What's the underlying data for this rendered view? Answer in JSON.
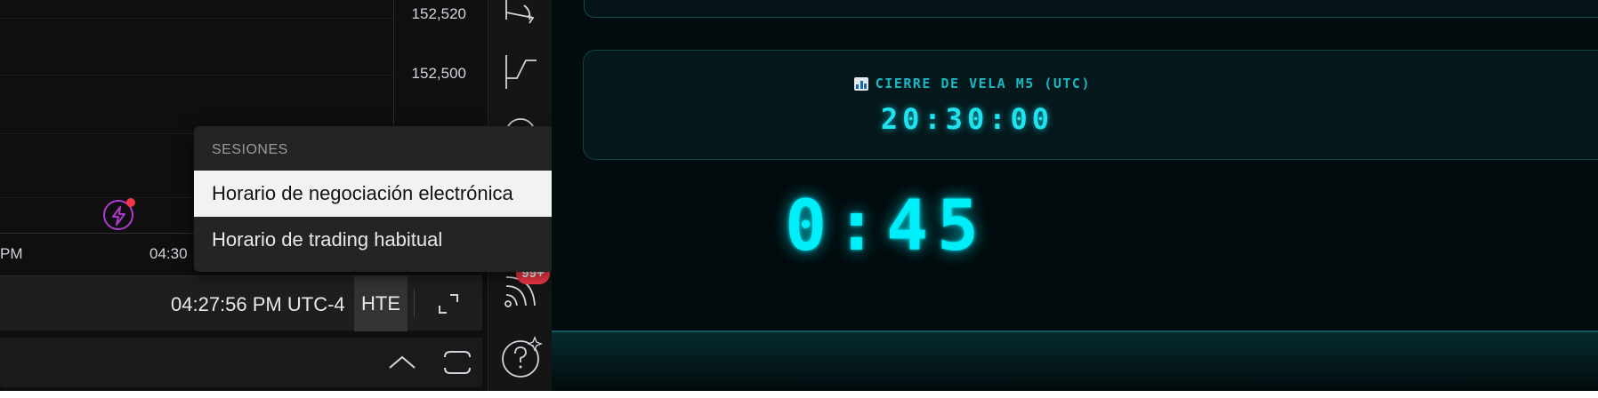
{
  "chart": {
    "price_labels": [
      "152,520",
      "152,500"
    ],
    "time_labels": [
      "PM",
      "04:30"
    ]
  },
  "status_bar": {
    "clock": "04:27:56 PM UTC-4",
    "session_button": "HTE"
  },
  "session_menu": {
    "header": "SESIONES",
    "items": [
      {
        "label": "Horario de negociación electrónica",
        "selected": true
      },
      {
        "label": "Horario de trading habitual",
        "selected": false
      }
    ]
  },
  "toolbar": {
    "notification_badge": "99+",
    "icons": [
      "trend-angle-icon",
      "pitchfork-icon",
      "circle-tool-icon",
      "signal-feed-icon",
      "help-sparkle-icon"
    ]
  },
  "candle_panel": {
    "label": "CIERRE DE VELA M5 (UTC)",
    "close_time": "20:30:00",
    "countdown": "0:45"
  },
  "colors": {
    "accent_cyan": "#00eefa",
    "panel_border": "#114348",
    "event_purple": "#b03acf",
    "badge_red": "#f23645"
  }
}
